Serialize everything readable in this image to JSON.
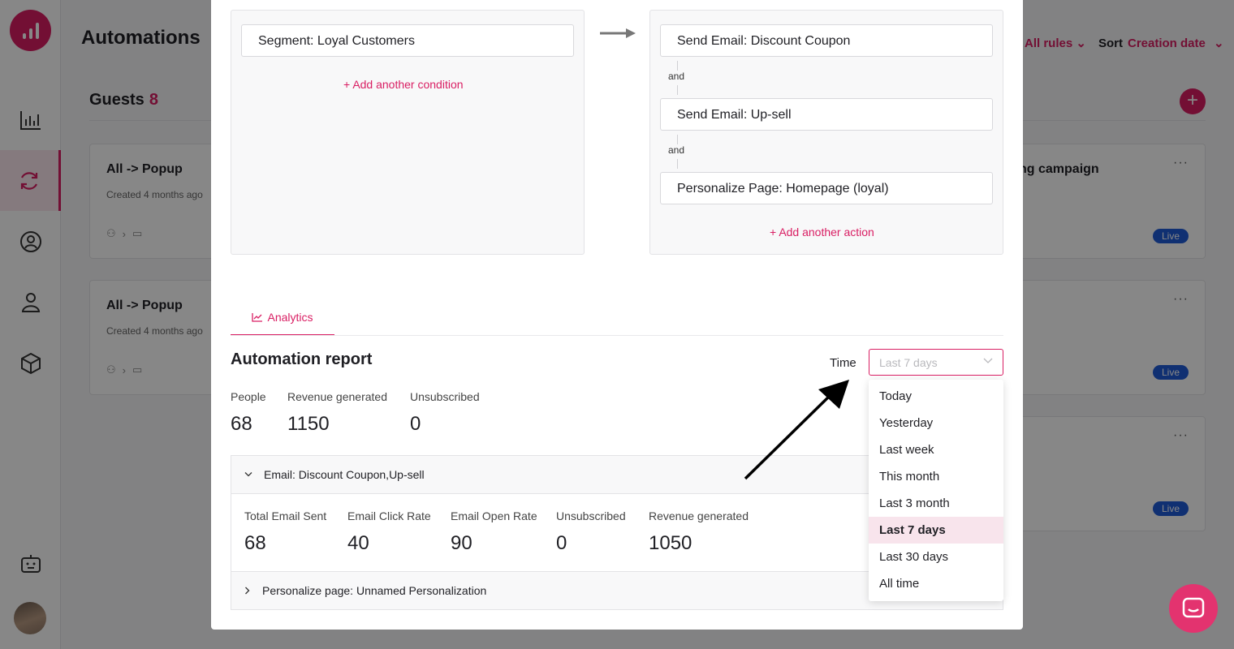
{
  "app": {
    "page_title": "Automations",
    "filter_label": "All rules",
    "sort_label": "Sort",
    "sort_value": "Creation date",
    "section_title": "Guests",
    "section_count": "8"
  },
  "cards": [
    {
      "title": "All -> Popup",
      "subtitle": "Created 4 months ago"
    },
    {
      "title": "All -> Popup",
      "subtitle": "Created 4 months ago"
    },
    {
      "title": "ng campaign",
      "badge": "Live"
    },
    {
      "badge": "Live"
    },
    {
      "badge": "Live"
    }
  ],
  "rule": {
    "condition": "Segment: Loyal Customers",
    "add_condition": "Add another condition",
    "actions": [
      "Send Email: Discount Coupon",
      "Send Email: Up-sell",
      "Personalize Page: Homepage (loyal)"
    ],
    "connector": "and",
    "add_action": "Add another action"
  },
  "tabs": {
    "analytics": "Analytics"
  },
  "report": {
    "title": "Automation report",
    "time_label": "Time",
    "time_placeholder": "Last 7 days",
    "summary": [
      {
        "label": "People",
        "value": "68"
      },
      {
        "label": "Revenue generated",
        "value": "1150"
      },
      {
        "label": "Unsubscribed",
        "value": "0"
      }
    ],
    "email_section": {
      "title": "Email: Discount Coupon,Up-sell",
      "metrics": [
        {
          "label": "Total Email Sent",
          "value": "68"
        },
        {
          "label": "Email Click Rate",
          "value": "40"
        },
        {
          "label": "Email Open Rate",
          "value": "90"
        },
        {
          "label": "Unsubscribed",
          "value": "0"
        },
        {
          "label": "Revenue generated",
          "value": "1050"
        }
      ]
    },
    "personalize_section": {
      "title": "Personalize page: Unnamed Personalization"
    }
  },
  "time_options": [
    "Today",
    "Yesterday",
    "Last week",
    "This month",
    "Last 3 month",
    "Last 7 days",
    "Last 30 days",
    "All time"
  ],
  "time_selected": "Last 7 days",
  "colors": {
    "accent": "#d91e63",
    "live_badge": "#1f5bd8",
    "chat": "#e3336f"
  }
}
